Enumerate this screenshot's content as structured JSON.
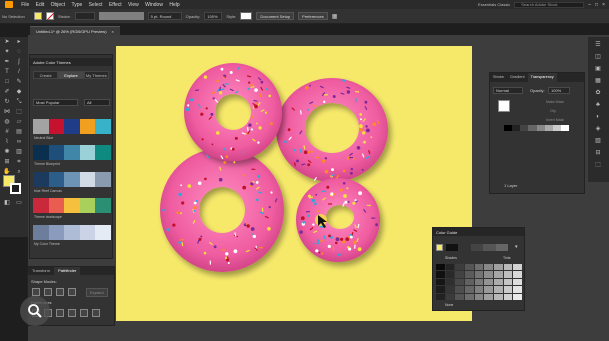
{
  "menubar": {
    "items": [
      "File",
      "Edit",
      "Object",
      "Type",
      "Select",
      "Effect",
      "View",
      "Window",
      "Help"
    ],
    "workspace": "Essentials Classic",
    "search_placeholder": "Search Adobe Stock"
  },
  "controlbar": {
    "selection": "No Selection",
    "stroke_label": "Stroke:",
    "brush": "5 pt. Round",
    "opacity_label": "Opacity:",
    "opacity_value": "100%",
    "style_label": "Style:",
    "doc_setup": "Document Setup",
    "preferences": "Preferences"
  },
  "document": {
    "tab_title": "Untitled-1* @ 26% (RGB/GPU Preview)"
  },
  "themes_panel": {
    "title": "Adobe Color Themes",
    "tabs": [
      "Create",
      "Explore",
      "My Themes"
    ],
    "active_tab": "Explore",
    "filter": "Most Popular",
    "filter2": "All",
    "themes": [
      {
        "name": "Neutral Blue",
        "colors": [
          "#a3a3a3",
          "#c4122f",
          "#1f3c88",
          "#f0a01e",
          "#38b2c8"
        ]
      },
      {
        "name": "Theme Blueprint",
        "colors": [
          "#0b2f4e",
          "#1e4f7a",
          "#3f86a8",
          "#9ad0d8",
          "#0f8a80"
        ]
      },
      {
        "name": "blue Reef Canvas",
        "colors": [
          "#1c3a5e",
          "#2d5e8a",
          "#6d93b5",
          "#d0dbe6",
          "#8a9bb0"
        ]
      },
      {
        "name": "Theme landscape",
        "colors": [
          "#c9293b",
          "#e85d4f",
          "#f4c03d",
          "#a8d05a",
          "#2b8f73"
        ]
      },
      {
        "name": "My Color Theme",
        "colors": [
          "#6d7d9c",
          "#8a9bbd",
          "#aebcd6",
          "#cad4e6",
          "#e5ebf4"
        ]
      }
    ]
  },
  "pathfinder_panel": {
    "tabs": [
      "Transform",
      "Pathfinder"
    ],
    "active_tab": "Pathfinder",
    "shape_modes": "Shape Modes:",
    "expand": "Expand",
    "pathfinders": "Pathfinders:"
  },
  "transparency_panel": {
    "tabs": [
      "Stroke",
      "Gradient",
      "Transparency"
    ],
    "active_tab": "Transparency",
    "blend": "Normal",
    "opacity_label": "Opacity:",
    "opacity_value": "100%",
    "make_mask": "Make Mask",
    "clip": "Clip",
    "invert": "Invert Mask",
    "layers_label": "1 Layer"
  },
  "guide_panel": {
    "title": "Color Guide",
    "shades": "Shades",
    "tints": "Tints",
    "none": "None"
  },
  "artboard_color": "#f6e96a",
  "donut_color": "#ef5ca0",
  "accent": "#ff9a00"
}
